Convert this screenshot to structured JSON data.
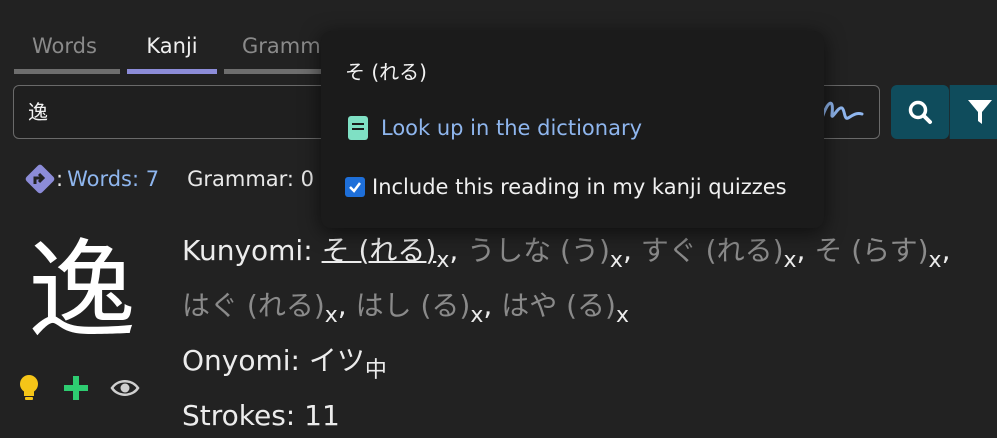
{
  "tabs": [
    {
      "label": "Words",
      "active": false
    },
    {
      "label": "Kanji",
      "active": true
    },
    {
      "label": "Gramm",
      "active": false
    }
  ],
  "search": {
    "value": "逸"
  },
  "counts": {
    "words_label": "Words: 7",
    "grammar_label": "Grammar: 0",
    "separator": ":"
  },
  "kanji": {
    "character": "逸",
    "kunyomi_label": "Kunyomi:",
    "kunyomi": [
      {
        "reading": "そ (れる)",
        "tag": "x",
        "highlighted": true
      },
      {
        "reading": "うしな (う)",
        "tag": "x",
        "highlighted": false
      },
      {
        "reading": "すぐ (れる)",
        "tag": "x",
        "highlighted": false
      },
      {
        "reading": "そ (らす)",
        "tag": "x",
        "highlighted": false
      },
      {
        "reading": "はぐ (れる)",
        "tag": "x",
        "highlighted": false
      },
      {
        "reading": "はし (る)",
        "tag": "x",
        "highlighted": false
      },
      {
        "reading": "はや (る)",
        "tag": "x",
        "highlighted": false
      }
    ],
    "onyomi_label": "Onyomi:",
    "onyomi": "イツ",
    "onyomi_tag": "中",
    "strokes_label": "Strokes: 11"
  },
  "popup": {
    "title": "そ (れる)",
    "lookup_label": "Look up in the dictionary",
    "include_label": "Include this reading in my kanji quizzes",
    "include_checked": true
  },
  "colors": {
    "accent": "#8c8cd8",
    "link": "#8fb6ee",
    "button": "#0f4c5c",
    "checkbox": "#1e6fd9"
  }
}
